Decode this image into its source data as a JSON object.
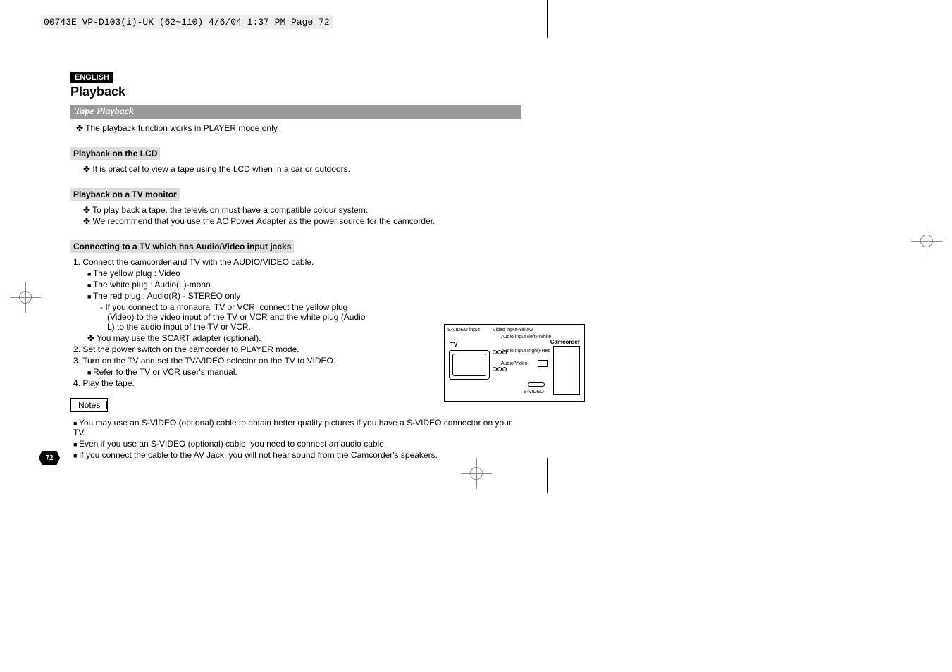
{
  "header": {
    "file_info": "00743E VP-D103(i)-UK (62~110)  4/6/04 1:37 PM  Page 72"
  },
  "lang_badge": "ENGLISH",
  "main_title": "Playback",
  "section1": {
    "title": "Tape Playback",
    "bullet": "✤  The playback function works in PLAYER mode only."
  },
  "section2": {
    "title": "Playback on the LCD",
    "bullet": "✤  It is practical to view a tape using the LCD when in a car or outdoors."
  },
  "section3": {
    "title": "Playback on a TV monitor",
    "bullets": [
      "✤  To play back a tape, the television must have a compatible colour system.",
      "✤  We recommend that you use the AC Power Adapter as the power source for the camcorder."
    ]
  },
  "section4": {
    "title": "Connecting to a TV which has Audio/Video input jacks",
    "items": {
      "n1": "1.  Connect the camcorder and TV with the AUDIO/VIDEO cable.",
      "s1": "The yellow plug : Video",
      "s2": "The white plug : Audio(L)-mono",
      "s3": "The red plug : Audio(R) - STEREO only",
      "d1": "-   If you connect to a monaural TV or VCR, connect the yellow plug (Video) to the video input of the TV or VCR and the white plug (Audio L) to the audio input of the TV or VCR.",
      "p1": "✤  You may use the SCART adapter (optional).",
      "n2": "2.  Set the power switch on the camcorder to PLAYER mode.",
      "n3": "3.  Turn on the TV and set the TV/VIDEO selector on the TV to VIDEO.",
      "s4": "Refer to the TV or VCR user's manual.",
      "n4": "4.  Play the tape."
    }
  },
  "notes": {
    "label": "Notes",
    "items": [
      "You may use an S-VIDEO (optional) cable to obtain better quality pictures if you have a S-VIDEO connector on your TV.",
      "Even if you use an S-VIDEO (optional) cable, you need to connect an audio cable.",
      "If you connect the cable to the AV Jack, you will not hear sound from the Camcorder's speakers."
    ]
  },
  "diagram": {
    "svideo_input": "S-VIDEO input",
    "video_input": "Video input-Yellow",
    "audio_left": "Audio input (left)-White",
    "audio_right": "Audio input (right)-Red",
    "audio_video": "Audio/Video",
    "svideo": "S-VIDEO",
    "tv": "TV",
    "camcorder": "Camcorder"
  },
  "page_number": "72"
}
